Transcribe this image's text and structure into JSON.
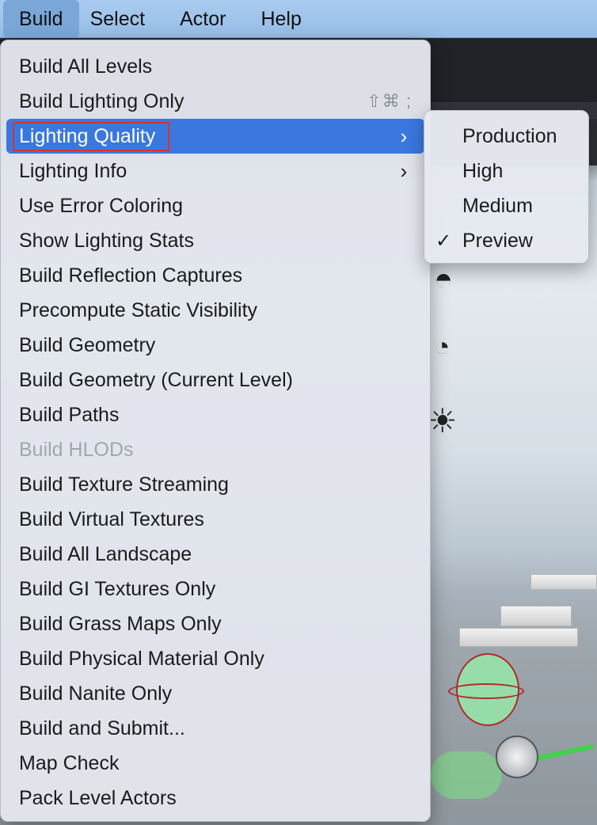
{
  "menubar": {
    "items": [
      "Build",
      "Select",
      "Actor",
      "Help"
    ]
  },
  "build_menu": {
    "items": [
      {
        "label": "Build All Levels"
      },
      {
        "label": "Build Lighting Only",
        "shortcut": "⇧⌘ ;"
      },
      {
        "label": "Lighting Quality",
        "submenu": true,
        "highlighted": true
      },
      {
        "label": "Lighting Info",
        "submenu": true
      },
      {
        "label": "Use Error Coloring"
      },
      {
        "label": "Show Lighting Stats"
      },
      {
        "label": "Build Reflection Captures"
      },
      {
        "label": "Precompute Static Visibility"
      },
      {
        "label": "Build Geometry"
      },
      {
        "label": "Build Geometry (Current Level)"
      },
      {
        "label": "Build Paths"
      },
      {
        "label": "Build HLODs",
        "disabled": true
      },
      {
        "label": "Build Texture Streaming"
      },
      {
        "label": "Build Virtual Textures"
      },
      {
        "label": "Build All Landscape"
      },
      {
        "label": "Build GI Textures Only"
      },
      {
        "label": "Build Grass Maps Only"
      },
      {
        "label": "Build Physical Material Only"
      },
      {
        "label": "Build Nanite Only"
      },
      {
        "label": "Build and Submit..."
      },
      {
        "label": "Map Check"
      },
      {
        "label": "Pack Level Actors"
      }
    ],
    "chevron": "›"
  },
  "lighting_quality_submenu": {
    "items": [
      {
        "label": "Production",
        "checked": false
      },
      {
        "label": "High",
        "checked": false
      },
      {
        "label": "Medium",
        "checked": false
      },
      {
        "label": "Preview",
        "checked": true
      }
    ],
    "check_glyph": "✓"
  },
  "colors": {
    "highlight": "#3a78e0",
    "annotation_box": "#d8332c",
    "menubar": "#a9cbef"
  }
}
